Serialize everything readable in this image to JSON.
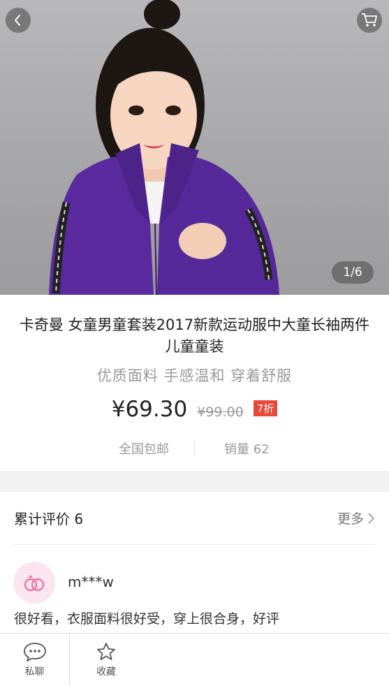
{
  "hero": {
    "page_indicator": "1/6"
  },
  "product": {
    "title": "卡奇曼 女童男童套装2017新款运动服中大童长袖两件儿童童装",
    "subtitle": "优质面料 手感温和 穿着舒服",
    "price": "¥69.30",
    "original_price": "¥99.00",
    "discount": "7折",
    "shipping": "全国包邮",
    "sales": "销量 62"
  },
  "reviews": {
    "title": "累计评价 6",
    "more_label": "更多",
    "items": [
      {
        "user": "m***w",
        "text": "很好看，衣服面料很好受，穿上很合身，好评"
      }
    ]
  },
  "bottom_bar": {
    "chat_label": "私聊",
    "favorite_label": "收藏"
  },
  "colors": {
    "jacket": "#5a2a9e",
    "discount_badge": "#e8483a",
    "avatar_bg": "#fbe6ef",
    "avatar_icon": "#f06b9b"
  },
  "icons": {
    "back": "chevron-left-icon",
    "cart": "cart-icon",
    "chat": "chat-bubble-icon",
    "favorite": "star-icon",
    "avatar": "rings-icon",
    "more": "chevron-right-icon"
  }
}
